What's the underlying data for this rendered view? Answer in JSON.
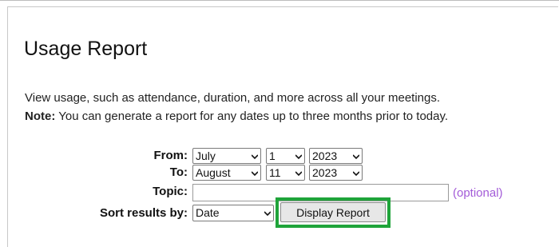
{
  "header": {
    "title": "Usage Report"
  },
  "intro": {
    "description": "View usage, such as attendance, duration, and more across all your meetings.",
    "note_label": "Note:",
    "note_text": " You can generate a report for any dates up to three months prior to today."
  },
  "form": {
    "from_label": "From:",
    "from": {
      "month": "July",
      "day": "1",
      "year": "2023"
    },
    "to_label": "To:",
    "to": {
      "month": "August",
      "day": "11",
      "year": "2023"
    },
    "topic_label": "Topic:",
    "topic_value": "",
    "topic_hint": "(optional)",
    "sort_label": "Sort results by:",
    "sort_value": "Date",
    "submit_label": "Display Report"
  },
  "colors": {
    "highlight": "#1fa43a",
    "optional_text": "#a35bd8"
  },
  "icons": [
    "chevron-down-icon"
  ]
}
